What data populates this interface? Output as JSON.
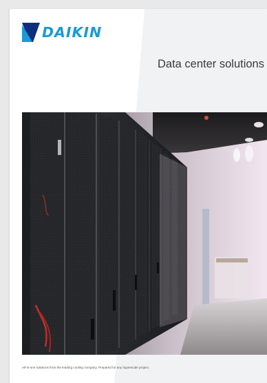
{
  "brand": {
    "name": "DAIKIN",
    "color": "#1a9ad7"
  },
  "cover": {
    "title": "Data center solutions",
    "footnote": "All-in-one solutions from the leading cooling company. Prepared for any hyperscale project."
  },
  "hero_image": {
    "subject": "server-racks-corridor-photo"
  }
}
